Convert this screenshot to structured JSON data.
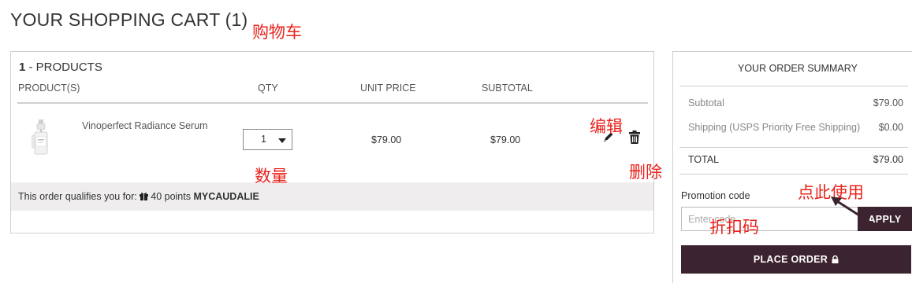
{
  "page": {
    "title": "YOUR SHOPPING CART (1)"
  },
  "annotations": {
    "cart": "购物车",
    "qty": "数量",
    "edit": "编辑",
    "delete": "删除",
    "apply_here": "点此使用",
    "promo": "折扣码"
  },
  "cart": {
    "count": "1",
    "count_suffix": " - PRODUCTS",
    "columns": {
      "product": "PRODUCT(S)",
      "qty": "QTY",
      "unit_price": "UNIT PRICE",
      "subtotal": "SUBTOTAL"
    },
    "items": [
      {
        "name": "Vinoperfect Radiance Serum",
        "qty": "1",
        "unit_price": "$79.00",
        "subtotal": "$79.00"
      }
    ],
    "points_prefix": "This order qualifies you for: ",
    "points_amount": "40 points ",
    "points_brand": "MYCAUDALIE"
  },
  "summary": {
    "title": "YOUR ORDER SUMMARY",
    "subtotal_label": "Subtotal",
    "subtotal_value": "$79.00",
    "shipping_label": "Shipping (USPS Priority Free Shipping)",
    "shipping_value": "$0.00",
    "total_label": "TOTAL",
    "total_value": "$79.00",
    "promo_label": "Promotion code",
    "promo_placeholder": "Enter code",
    "apply_label": "APPLY",
    "place_order_label": "PLACE ORDER"
  },
  "colors": {
    "brand": "#3c2330",
    "annotation": "#e8231c",
    "points_bar": "#efedee"
  }
}
